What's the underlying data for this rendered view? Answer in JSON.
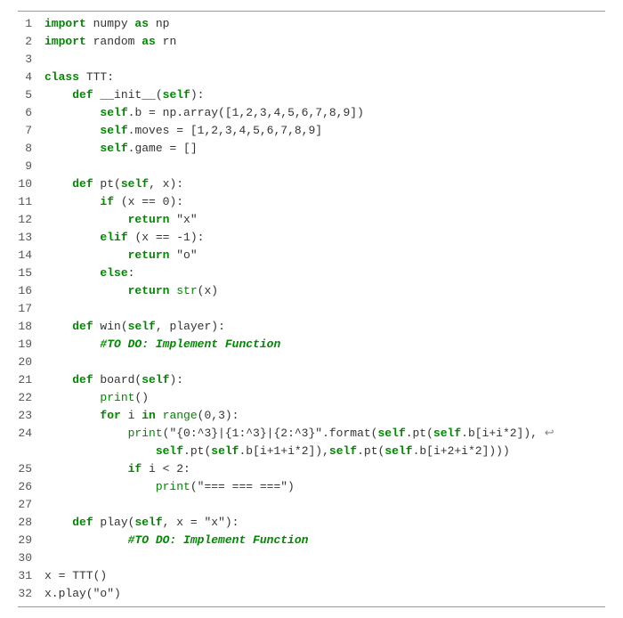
{
  "lines": [
    {
      "n": "1",
      "tokens": [
        {
          "cls": "kw-import",
          "t": "import"
        },
        {
          "cls": "",
          "t": " numpy "
        },
        {
          "cls": "kw-as",
          "t": "as"
        },
        {
          "cls": "",
          "t": " np"
        }
      ]
    },
    {
      "n": "2",
      "tokens": [
        {
          "cls": "kw-import",
          "t": "import"
        },
        {
          "cls": "",
          "t": " random "
        },
        {
          "cls": "kw-as",
          "t": "as"
        },
        {
          "cls": "",
          "t": " rn"
        }
      ]
    },
    {
      "n": "3",
      "tokens": []
    },
    {
      "n": "4",
      "tokens": [
        {
          "cls": "kw-class",
          "t": "class"
        },
        {
          "cls": "",
          "t": " TTT:"
        }
      ]
    },
    {
      "n": "5",
      "tokens": [
        {
          "cls": "",
          "t": "    "
        },
        {
          "cls": "kw-def",
          "t": "def"
        },
        {
          "cls": "",
          "t": " __init__("
        },
        {
          "cls": "kw-self",
          "t": "self"
        },
        {
          "cls": "",
          "t": "):"
        }
      ]
    },
    {
      "n": "6",
      "tokens": [
        {
          "cls": "",
          "t": "        "
        },
        {
          "cls": "kw-self",
          "t": "self"
        },
        {
          "cls": "",
          "t": ".b = np.array([1,2,3,4,5,6,7,8,9])"
        }
      ]
    },
    {
      "n": "7",
      "tokens": [
        {
          "cls": "",
          "t": "        "
        },
        {
          "cls": "kw-self",
          "t": "self"
        },
        {
          "cls": "",
          "t": ".moves = [1,2,3,4,5,6,7,8,9]"
        }
      ]
    },
    {
      "n": "8",
      "tokens": [
        {
          "cls": "",
          "t": "        "
        },
        {
          "cls": "kw-self",
          "t": "self"
        },
        {
          "cls": "",
          "t": ".game = []"
        }
      ]
    },
    {
      "n": "9",
      "tokens": []
    },
    {
      "n": "10",
      "tokens": [
        {
          "cls": "",
          "t": "    "
        },
        {
          "cls": "kw-def",
          "t": "def"
        },
        {
          "cls": "",
          "t": " pt("
        },
        {
          "cls": "kw-self",
          "t": "self"
        },
        {
          "cls": "",
          "t": ", x):"
        }
      ]
    },
    {
      "n": "11",
      "tokens": [
        {
          "cls": "",
          "t": "        "
        },
        {
          "cls": "kw-if",
          "t": "if"
        },
        {
          "cls": "",
          "t": " (x == 0):"
        }
      ]
    },
    {
      "n": "12",
      "tokens": [
        {
          "cls": "",
          "t": "            "
        },
        {
          "cls": "kw-return",
          "t": "return"
        },
        {
          "cls": "",
          "t": " \"x\""
        }
      ]
    },
    {
      "n": "13",
      "tokens": [
        {
          "cls": "",
          "t": "        "
        },
        {
          "cls": "kw-elif",
          "t": "elif"
        },
        {
          "cls": "",
          "t": " (x == -1):"
        }
      ]
    },
    {
      "n": "14",
      "tokens": [
        {
          "cls": "",
          "t": "            "
        },
        {
          "cls": "kw-return",
          "t": "return"
        },
        {
          "cls": "",
          "t": " \"o\""
        }
      ]
    },
    {
      "n": "15",
      "tokens": [
        {
          "cls": "",
          "t": "        "
        },
        {
          "cls": "kw-else",
          "t": "else"
        },
        {
          "cls": "",
          "t": ":"
        }
      ]
    },
    {
      "n": "16",
      "tokens": [
        {
          "cls": "",
          "t": "            "
        },
        {
          "cls": "kw-return",
          "t": "return"
        },
        {
          "cls": "",
          "t": " "
        },
        {
          "cls": "builtin",
          "t": "str"
        },
        {
          "cls": "",
          "t": "(x)"
        }
      ]
    },
    {
      "n": "17",
      "tokens": []
    },
    {
      "n": "18",
      "tokens": [
        {
          "cls": "",
          "t": "    "
        },
        {
          "cls": "kw-def",
          "t": "def"
        },
        {
          "cls": "",
          "t": " win("
        },
        {
          "cls": "kw-self",
          "t": "self"
        },
        {
          "cls": "",
          "t": ", player):"
        }
      ]
    },
    {
      "n": "19",
      "tokens": [
        {
          "cls": "",
          "t": "        "
        },
        {
          "cls": "comment",
          "t": "#TO DO: Implement Function"
        }
      ]
    },
    {
      "n": "20",
      "tokens": []
    },
    {
      "n": "21",
      "tokens": [
        {
          "cls": "",
          "t": "    "
        },
        {
          "cls": "kw-def",
          "t": "def"
        },
        {
          "cls": "",
          "t": " board("
        },
        {
          "cls": "kw-self",
          "t": "self"
        },
        {
          "cls": "",
          "t": "):"
        }
      ]
    },
    {
      "n": "22",
      "tokens": [
        {
          "cls": "",
          "t": "        "
        },
        {
          "cls": "builtin",
          "t": "print"
        },
        {
          "cls": "",
          "t": "()"
        }
      ]
    },
    {
      "n": "23",
      "tokens": [
        {
          "cls": "",
          "t": "        "
        },
        {
          "cls": "kw-for",
          "t": "for"
        },
        {
          "cls": "",
          "t": " i "
        },
        {
          "cls": "kw-in",
          "t": "in"
        },
        {
          "cls": "",
          "t": " "
        },
        {
          "cls": "builtin",
          "t": "range"
        },
        {
          "cls": "",
          "t": "(0,3):"
        }
      ]
    },
    {
      "n": "24",
      "tokens": [
        {
          "cls": "",
          "t": "            "
        },
        {
          "cls": "builtin",
          "t": "print"
        },
        {
          "cls": "",
          "t": "(\"{0:^3}|{1:^3}|{2:^3}\".format("
        },
        {
          "cls": "kw-self",
          "t": "self"
        },
        {
          "cls": "",
          "t": ".pt("
        },
        {
          "cls": "kw-self",
          "t": "self"
        },
        {
          "cls": "",
          "t": ".b[i+i*2]), "
        },
        {
          "cls": "wrap-arrow",
          "t": "↩"
        }
      ]
    },
    {
      "n": "",
      "tokens": [
        {
          "cls": "",
          "t": "                "
        },
        {
          "cls": "kw-self",
          "t": "self"
        },
        {
          "cls": "",
          "t": ".pt("
        },
        {
          "cls": "kw-self",
          "t": "self"
        },
        {
          "cls": "",
          "t": ".b[i+1+i*2]),"
        },
        {
          "cls": "kw-self",
          "t": "self"
        },
        {
          "cls": "",
          "t": ".pt("
        },
        {
          "cls": "kw-self",
          "t": "self"
        },
        {
          "cls": "",
          "t": ".b[i+2+i*2])))"
        }
      ]
    },
    {
      "n": "25",
      "tokens": [
        {
          "cls": "",
          "t": "            "
        },
        {
          "cls": "kw-if",
          "t": "if"
        },
        {
          "cls": "",
          "t": " i < 2:"
        }
      ]
    },
    {
      "n": "26",
      "tokens": [
        {
          "cls": "",
          "t": "                "
        },
        {
          "cls": "builtin",
          "t": "print"
        },
        {
          "cls": "",
          "t": "(\"=== === ===\")"
        }
      ]
    },
    {
      "n": "27",
      "tokens": []
    },
    {
      "n": "28",
      "tokens": [
        {
          "cls": "",
          "t": "    "
        },
        {
          "cls": "kw-def",
          "t": "def"
        },
        {
          "cls": "",
          "t": " play("
        },
        {
          "cls": "kw-self",
          "t": "self"
        },
        {
          "cls": "",
          "t": ", x = \"x\"):"
        }
      ]
    },
    {
      "n": "29",
      "tokens": [
        {
          "cls": "",
          "t": "            "
        },
        {
          "cls": "comment",
          "t": "#TO DO: Implement Function"
        }
      ]
    },
    {
      "n": "30",
      "tokens": []
    },
    {
      "n": "31",
      "tokens": [
        {
          "cls": "",
          "t": "x = TTT()"
        }
      ]
    },
    {
      "n": "32",
      "tokens": [
        {
          "cls": "",
          "t": "x.play(\"o\")"
        }
      ]
    }
  ]
}
